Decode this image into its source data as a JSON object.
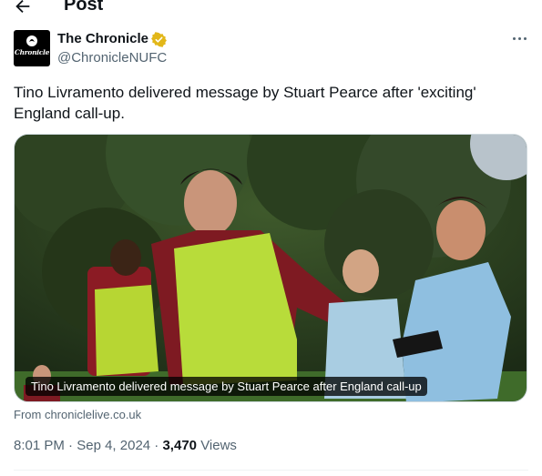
{
  "header": {
    "title": "Post"
  },
  "icons": {
    "back": "arrow-left-icon",
    "verified": "verified-badge-icon",
    "more": "more-horizontal-icon"
  },
  "author": {
    "name": "The Chronicle",
    "handle": "@ChronicleNUFC",
    "avatar_text": "Chronicle"
  },
  "post": {
    "text": "Tino Livramento delivered message by Stuart Pearce after 'exciting' England call-up.",
    "media_caption": "Tino Livramento delivered message by Stuart Pearce after England call-up",
    "link_source": "From chroniclelive.co.uk"
  },
  "meta": {
    "time": "8:01 PM",
    "date": "Sep 4, 2024",
    "separator": "·",
    "views_count": "3,470",
    "views_label": "Views"
  },
  "colors": {
    "text": "#0f1419",
    "secondary": "#536471",
    "verified": "#e2b719",
    "border": "#cfd9de"
  }
}
